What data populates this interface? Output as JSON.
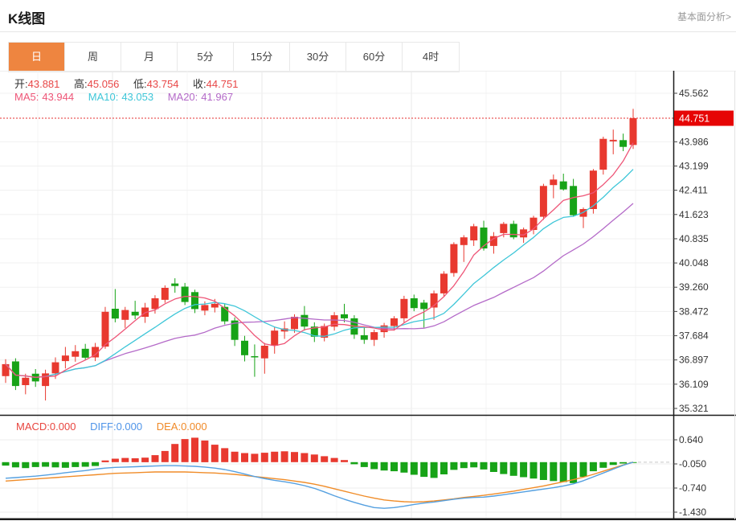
{
  "header": {
    "title": "K线图",
    "link_label": "基本面分析>"
  },
  "tabs": {
    "items": [
      "日",
      "周",
      "月",
      "5分",
      "15分",
      "30分",
      "60分",
      "4时"
    ],
    "selected_index": 0
  },
  "readout": {
    "open_label": "开:",
    "open": "43.881",
    "high_label": "高:",
    "high": "45.056",
    "low_label": "低:",
    "low": "43.754",
    "close_label": "收:",
    "close": "44.751",
    "ma5_label": "MA5:",
    "ma5": "43.944",
    "ma10_label": "MA10:",
    "ma10": "43.053",
    "ma20_label": "MA20:",
    "ma20": "41.967",
    "macd_label": "MACD:",
    "macd": "0.000",
    "diff_label": "DIFF:",
    "diff": "0.000",
    "dea_label": "DEA:",
    "dea": "0.000"
  },
  "colors": {
    "up": "#e8392f",
    "down": "#17a317",
    "tag_bg": "#e60505",
    "tag_text": "#ffffff",
    "ma5": "#ee5577",
    "ma10": "#3ec6d8",
    "ma20": "#b46ac8",
    "diff_line": "#55a0e0",
    "dea_line": "#f08c28",
    "tab_selected_bg": "#ee8540",
    "current_price_line": "#e63030",
    "axis": "#1a1a1a",
    "grid": "#f0f0f0",
    "tick_text": "#333333"
  },
  "chart_data": {
    "type": "candlestick",
    "title": "K线图 (daily K-line with MA5/MA10/MA20 overlays and MACD histogram sub-chart)",
    "legend": [
      "MA5",
      "MA10",
      "MA20"
    ],
    "ma_periods": [
      5,
      10,
      20
    ],
    "price_range": [
      35.321,
      45.562
    ],
    "price_ticks": [
      "45.562",
      "43.986",
      "43.199",
      "42.411",
      "41.623",
      "40.835",
      "40.048",
      "39.260",
      "38.472",
      "37.684",
      "36.897",
      "36.109",
      "35.321"
    ],
    "current_price": "44.751",
    "candles": [
      [
        36.37,
        36.92,
        36.15,
        36.76
      ],
      [
        36.85,
        36.95,
        35.92,
        36.05
      ],
      [
        36.08,
        36.45,
        35.78,
        36.32
      ],
      [
        36.45,
        36.6,
        36.02,
        36.2
      ],
      [
        36.05,
        36.58,
        35.58,
        36.46
      ],
      [
        36.46,
        36.98,
        36.28,
        36.82
      ],
      [
        36.86,
        37.32,
        36.62,
        37.04
      ],
      [
        37.0,
        37.38,
        36.84,
        37.18
      ],
      [
        37.26,
        37.42,
        36.88,
        36.97
      ],
      [
        36.98,
        37.45,
        36.86,
        37.32
      ],
      [
        37.33,
        38.62,
        37.26,
        38.46
      ],
      [
        38.56,
        39.2,
        38.12,
        38.24
      ],
      [
        38.2,
        38.62,
        37.94,
        38.52
      ],
      [
        38.46,
        38.82,
        38.22,
        38.34
      ],
      [
        38.3,
        38.75,
        38.1,
        38.6
      ],
      [
        38.55,
        39.0,
        38.4,
        38.9
      ],
      [
        38.85,
        39.32,
        38.75,
        39.24
      ],
      [
        39.38,
        39.55,
        39.08,
        39.3
      ],
      [
        39.28,
        39.4,
        38.68,
        38.78
      ],
      [
        39.1,
        39.18,
        38.42,
        38.55
      ],
      [
        38.5,
        38.8,
        38.35,
        38.68
      ],
      [
        38.6,
        38.88,
        38.44,
        38.72
      ],
      [
        38.62,
        38.72,
        38.05,
        38.15
      ],
      [
        38.18,
        38.28,
        37.35,
        37.55
      ],
      [
        37.52,
        37.68,
        36.85,
        37.05
      ],
      [
        37.02,
        37.4,
        36.35,
        36.98
      ],
      [
        36.95,
        37.45,
        36.45,
        37.36
      ],
      [
        37.36,
        37.98,
        37.1,
        37.85
      ],
      [
        37.82,
        38.15,
        37.58,
        37.92
      ],
      [
        37.9,
        38.38,
        37.78,
        38.3
      ],
      [
        38.36,
        38.65,
        37.85,
        37.98
      ],
      [
        37.98,
        38.12,
        37.48,
        37.65
      ],
      [
        37.62,
        38.08,
        37.5,
        38.0
      ],
      [
        37.98,
        38.45,
        37.85,
        38.35
      ],
      [
        38.38,
        38.72,
        38.12,
        38.25
      ],
      [
        38.25,
        38.35,
        37.58,
        37.72
      ],
      [
        37.7,
        37.95,
        37.42,
        37.55
      ],
      [
        37.55,
        37.88,
        37.35,
        37.8
      ],
      [
        37.8,
        38.1,
        37.62,
        38.02
      ],
      [
        38.0,
        38.32,
        37.85,
        38.25
      ],
      [
        38.25,
        38.98,
        38.1,
        38.88
      ],
      [
        38.9,
        39.02,
        38.48,
        38.58
      ],
      [
        38.76,
        38.85,
        37.95,
        38.55
      ],
      [
        38.6,
        39.15,
        38.2,
        39.06
      ],
      [
        39.06,
        39.78,
        38.95,
        39.7
      ],
      [
        39.72,
        40.72,
        39.6,
        40.66
      ],
      [
        40.63,
        40.95,
        40.08,
        40.88
      ],
      [
        40.78,
        41.32,
        40.6,
        41.24
      ],
      [
        41.2,
        41.42,
        40.45,
        40.52
      ],
      [
        40.6,
        41.05,
        40.35,
        40.92
      ],
      [
        41.02,
        41.38,
        40.88,
        41.32
      ],
      [
        41.32,
        41.42,
        40.82,
        40.88
      ],
      [
        40.88,
        41.2,
        40.7,
        41.14
      ],
      [
        41.12,
        41.58,
        40.98,
        41.52
      ],
      [
        41.55,
        42.62,
        41.45,
        42.55
      ],
      [
        42.58,
        42.92,
        42.15,
        42.76
      ],
      [
        42.7,
        42.95,
        42.4,
        42.44
      ],
      [
        42.55,
        42.78,
        41.55,
        41.6
      ],
      [
        41.55,
        41.85,
        41.18,
        41.8
      ],
      [
        41.8,
        43.1,
        41.65,
        43.05
      ],
      [
        43.08,
        44.15,
        42.92,
        44.08
      ],
      [
        44.0,
        44.38,
        43.58,
        44.05
      ],
      [
        44.04,
        44.25,
        43.68,
        43.82
      ],
      [
        43.881,
        45.056,
        43.754,
        44.751
      ]
    ],
    "macd": {
      "ticks": [
        "0.640",
        "-0.050",
        "-0.740",
        "-1.430"
      ],
      "range": [
        -1.43,
        0.64
      ],
      "bars": [
        -0.1,
        -0.15,
        -0.17,
        -0.14,
        -0.13,
        -0.15,
        -0.16,
        -0.14,
        -0.13,
        -0.11,
        0.05,
        0.1,
        0.12,
        0.11,
        0.13,
        0.2,
        0.32,
        0.52,
        0.66,
        0.7,
        0.62,
        0.5,
        0.4,
        0.3,
        0.26,
        0.24,
        0.27,
        0.3,
        0.31,
        0.29,
        0.26,
        0.22,
        0.17,
        0.12,
        0.06,
        -0.06,
        -0.14,
        -0.2,
        -0.24,
        -0.26,
        -0.3,
        -0.36,
        -0.42,
        -0.45,
        -0.35,
        -0.22,
        -0.17,
        -0.15,
        -0.21,
        -0.28,
        -0.34,
        -0.39,
        -0.43,
        -0.47,
        -0.51,
        -0.54,
        -0.57,
        -0.6,
        -0.42,
        -0.26,
        -0.16,
        -0.08,
        -0.04,
        -0.01
      ],
      "diff": [
        -0.46,
        -0.44,
        -0.42,
        -0.4,
        -0.37,
        -0.34,
        -0.3,
        -0.27,
        -0.24,
        -0.2,
        -0.17,
        -0.15,
        -0.14,
        -0.13,
        -0.12,
        -0.11,
        -0.1,
        -0.1,
        -0.11,
        -0.12,
        -0.14,
        -0.17,
        -0.21,
        -0.27,
        -0.34,
        -0.41,
        -0.47,
        -0.52,
        -0.56,
        -0.61,
        -0.67,
        -0.75,
        -0.85,
        -0.96,
        -1.06,
        -1.15,
        -1.23,
        -1.3,
        -1.32,
        -1.3,
        -1.26,
        -1.21,
        -1.17,
        -1.14,
        -1.1,
        -1.06,
        -1.03,
        -1.01,
        -1.0,
        -0.97,
        -0.93,
        -0.89,
        -0.85,
        -0.81,
        -0.77,
        -0.73,
        -0.68,
        -0.62,
        -0.53,
        -0.42,
        -0.31,
        -0.2,
        -0.09,
        0.0
      ],
      "dea": [
        -0.54,
        -0.52,
        -0.5,
        -0.48,
        -0.46,
        -0.44,
        -0.42,
        -0.4,
        -0.38,
        -0.36,
        -0.34,
        -0.32,
        -0.31,
        -0.3,
        -0.29,
        -0.28,
        -0.28,
        -0.28,
        -0.28,
        -0.29,
        -0.3,
        -0.31,
        -0.33,
        -0.35,
        -0.38,
        -0.41,
        -0.44,
        -0.47,
        -0.5,
        -0.54,
        -0.58,
        -0.63,
        -0.69,
        -0.76,
        -0.83,
        -0.9,
        -0.97,
        -1.03,
        -1.08,
        -1.11,
        -1.13,
        -1.14,
        -1.13,
        -1.11,
        -1.08,
        -1.05,
        -1.01,
        -0.98,
        -0.95,
        -0.91,
        -0.87,
        -0.83,
        -0.78,
        -0.73,
        -0.68,
        -0.62,
        -0.56,
        -0.5,
        -0.43,
        -0.35,
        -0.26,
        -0.17,
        -0.08,
        0.0
      ]
    }
  }
}
